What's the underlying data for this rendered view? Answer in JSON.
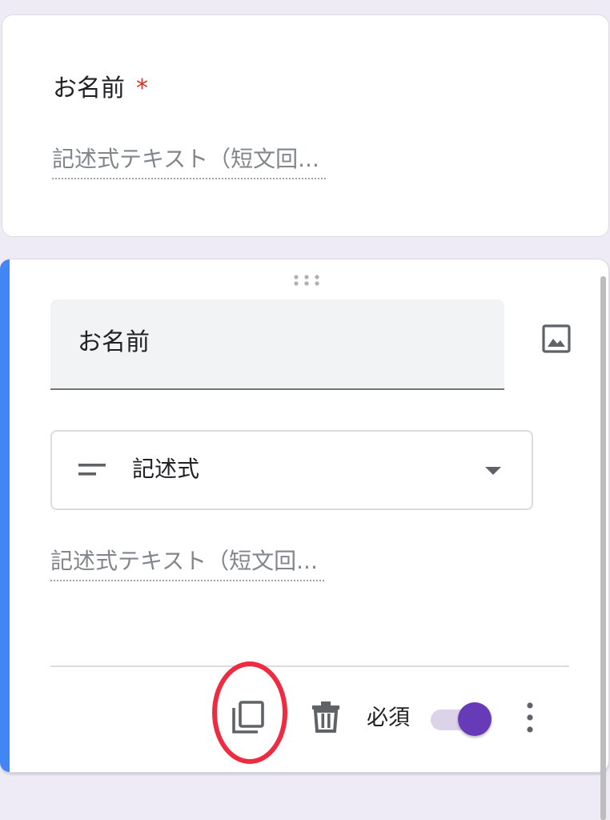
{
  "preview_card": {
    "question_title": "お名前",
    "required_mark": "*",
    "answer_placeholder": "記述式テキスト（短文回..."
  },
  "editor_card": {
    "question_title_value": "お名前",
    "question_type": {
      "icon": "short-text-icon",
      "selected_label": "記述式"
    },
    "answer_placeholder": "記述式テキスト（短文回...",
    "footer": {
      "copy_icon": "copy-icon",
      "delete_icon": "trash-icon",
      "required_label": "必須",
      "required_on": true,
      "more_icon": "more-vert-icon"
    }
  },
  "colors": {
    "page_background": "#efebf6",
    "accent_bar": "#4285f4",
    "toggle_on": "#673ab7",
    "required_star": "#d93025",
    "annotation": "#ef2b41"
  }
}
